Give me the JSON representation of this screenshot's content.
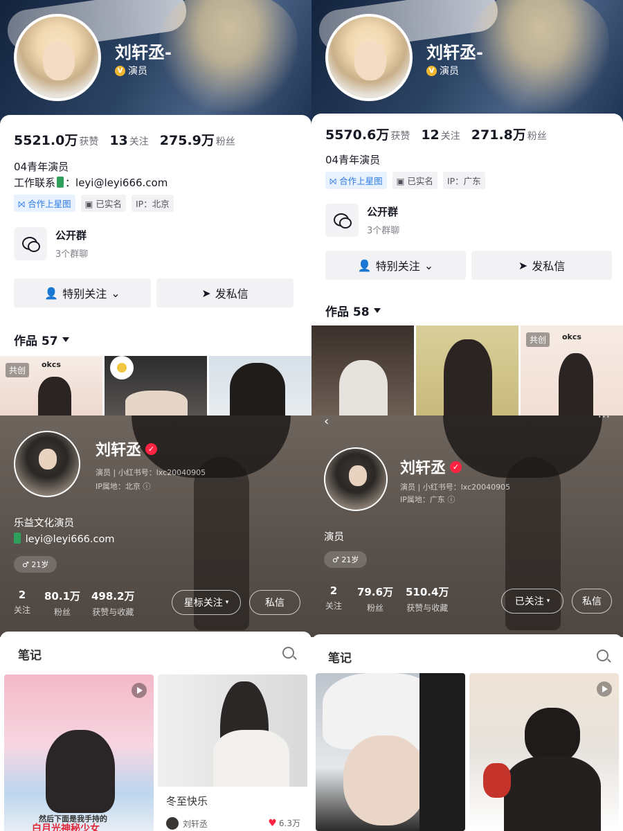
{
  "douyin_left": {
    "name": "刘轩丞-",
    "role": "演员",
    "stats": [
      {
        "num": "5521.0万",
        "label": "获赞"
      },
      {
        "num": "13",
        "label": "关注"
      },
      {
        "num": "275.9万",
        "label": "粉丝"
      }
    ],
    "bio_line1": "04青年演员",
    "contact_label": "工作联系",
    "contact_sep": "：",
    "contact_email": "leyi@leyi666.com",
    "tags": [
      "合作上星图",
      "已实名",
      "IP：北京"
    ],
    "group_title": "公开群",
    "group_sub": "3个群聊",
    "btn_follow": "特别关注",
    "btn_message": "发私信",
    "works_label": "作品 57",
    "thumb_coop": "共创",
    "thumb_brand": "okcs"
  },
  "douyin_right": {
    "name": "刘轩丞-",
    "role": "演员",
    "stats": [
      {
        "num": "5570.6万",
        "label": "获赞"
      },
      {
        "num": "12",
        "label": "关注"
      },
      {
        "num": "271.8万",
        "label": "粉丝"
      }
    ],
    "bio_line1": "04青年演员",
    "tags": [
      "合作上星图",
      "已实名",
      "IP：广东"
    ],
    "group_title": "公开群",
    "group_sub": "3个群聊",
    "btn_follow": "特别关注",
    "btn_message": "发私信",
    "works_label": "作品 58",
    "thumb_coop": "共创",
    "thumb_brand": "okcs"
  },
  "xhs_left": {
    "name": "刘轩丞",
    "meta_line1": "演员 | 小红书号：lxc20040905",
    "meta_line2": "IP属地：北京 ⓘ",
    "bio": "乐益文化演员",
    "email": "leyi@leyi666.com",
    "age": "♂ 21岁",
    "stats": [
      {
        "num": "2",
        "label": "关注"
      },
      {
        "num": "80.1万",
        "label": "粉丝"
      },
      {
        "num": "498.2万",
        "label": "获赞与收藏"
      }
    ],
    "btn_follow": "星标关注",
    "btn_message": "私信",
    "notes_tab": "笔记",
    "note1_cover_line1": "然后下面是我手持的",
    "note1_cover_line2": "白月光神秘少女",
    "note2_title": "冬至快乐",
    "note2_author": "刘轩丞",
    "note2_likes": "6.3万"
  },
  "xhs_right": {
    "name": "刘轩丞",
    "meta_line1": "演员 | 小红书号：lxc20040905",
    "meta_line2": "IP属地：广东 ⓘ",
    "bio": "演员",
    "age": "♂ 21岁",
    "stats": [
      {
        "num": "2",
        "label": "关注"
      },
      {
        "num": "79.6万",
        "label": "粉丝"
      },
      {
        "num": "510.4万",
        "label": "获赞与收藏"
      }
    ],
    "btn_follow": "已关注",
    "btn_message": "私信",
    "notes_tab": "笔记"
  },
  "colors": {
    "douyin_banner": "#1e3352",
    "xhs_red": "#ff2442",
    "verified_gold": "#f2b731",
    "xhs_bg": "#5a524c"
  },
  "icons": [
    "v-badge-icon",
    "phone-icon",
    "star-map-icon",
    "id-card-icon",
    "group-chat-icon",
    "follow-user-icon",
    "chevron-down-icon",
    "send-icon",
    "verified-check-icon",
    "male-icon",
    "search-icon",
    "play-icon",
    "heart-icon",
    "back-icon",
    "more-icon"
  ]
}
